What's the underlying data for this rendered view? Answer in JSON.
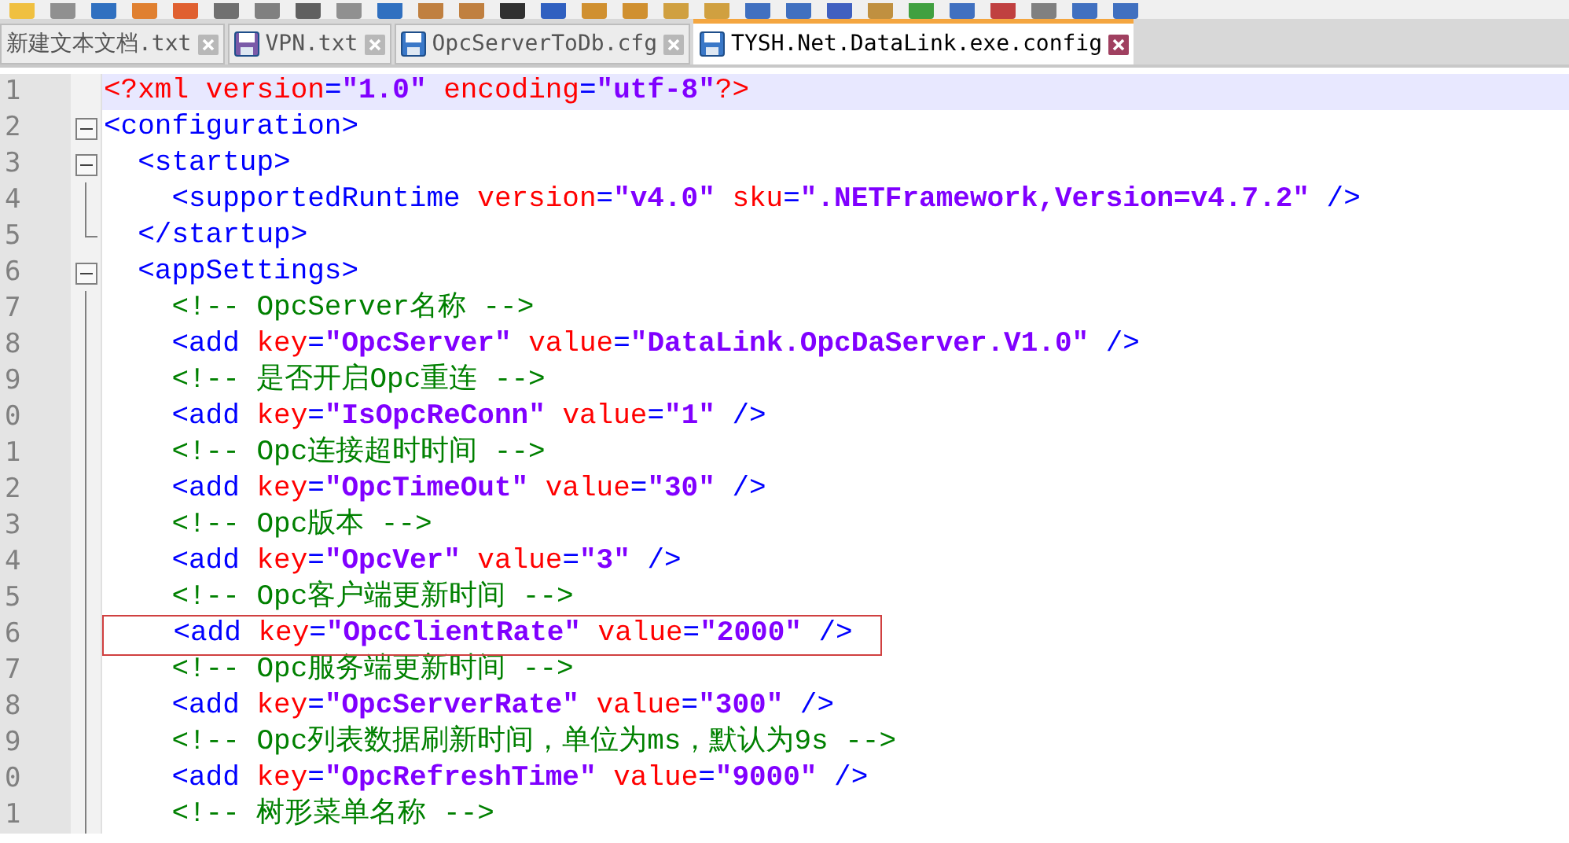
{
  "tabs": [
    {
      "label": "新建文本文档.txt",
      "selected": false,
      "icon": false
    },
    {
      "label": "VPN.txt",
      "selected": false,
      "icon": true,
      "modified": true
    },
    {
      "label": "OpcServerToDb.cfg",
      "selected": false,
      "icon": true,
      "modified": false
    },
    {
      "label": "TYSH.Net.DataLink.exe.config",
      "selected": true,
      "icon": true,
      "modified": false
    }
  ],
  "editor": {
    "lines": [
      {
        "number": "1",
        "kind": "plain",
        "current": true,
        "highlighted": false,
        "tokens": [
          {
            "kind": "pi",
            "text": "<?xml"
          },
          {
            "kind": "pi",
            "text": " version"
          },
          {
            "kind": "tag",
            "text": "="
          },
          {
            "kind": "val",
            "text": "\"1.0\""
          },
          {
            "kind": "pi",
            "text": " encoding"
          },
          {
            "kind": "tag",
            "text": "="
          },
          {
            "kind": "val",
            "text": "\"utf-8\""
          },
          {
            "kind": "pi",
            "text": "?>"
          }
        ]
      },
      {
        "number": "2",
        "kind": "fold-open",
        "current": false,
        "highlighted": false,
        "tokens": [
          {
            "kind": "tag",
            "text": "<configuration>"
          }
        ]
      },
      {
        "number": "3",
        "kind": "fold-open",
        "current": false,
        "highlighted": false,
        "tokens": [
          {
            "kind": "tag",
            "text": "  <startup>"
          }
        ]
      },
      {
        "number": "4",
        "kind": "fold-line",
        "current": false,
        "highlighted": false,
        "tokens": [
          {
            "kind": "tag",
            "text": "    <supportedRuntime"
          },
          {
            "kind": "attr",
            "text": " version"
          },
          {
            "kind": "tag",
            "text": "="
          },
          {
            "kind": "val",
            "text": "\"v4.0\""
          },
          {
            "kind": "attr",
            "text": " sku"
          },
          {
            "kind": "tag",
            "text": "="
          },
          {
            "kind": "val",
            "text": "\".NETFramework,Version=v4.7.2\""
          },
          {
            "kind": "tag",
            "text": " />"
          }
        ]
      },
      {
        "number": "5",
        "kind": "fold-end",
        "current": false,
        "highlighted": false,
        "tokens": [
          {
            "kind": "tag",
            "text": "  </startup>"
          }
        ]
      },
      {
        "number": "6",
        "kind": "fold-open",
        "current": false,
        "highlighted": false,
        "tokens": [
          {
            "kind": "tag",
            "text": "  <appSettings>"
          }
        ]
      },
      {
        "number": "7",
        "kind": "fold-line",
        "current": false,
        "highlighted": false,
        "tokens": [
          {
            "kind": "cmt",
            "text": "    <!-- OpcServer名称 -->"
          }
        ]
      },
      {
        "number": "8",
        "kind": "fold-line",
        "current": false,
        "highlighted": false,
        "tokens": [
          {
            "kind": "tag",
            "text": "    <add"
          },
          {
            "kind": "attr",
            "text": " key"
          },
          {
            "kind": "tag",
            "text": "="
          },
          {
            "kind": "val",
            "text": "\"OpcServer\""
          },
          {
            "kind": "attr",
            "text": " value"
          },
          {
            "kind": "tag",
            "text": "="
          },
          {
            "kind": "val",
            "text": "\"DataLink.OpcDaServer.V1.0\""
          },
          {
            "kind": "tag",
            "text": " />"
          }
        ]
      },
      {
        "number": "9",
        "kind": "fold-line",
        "current": false,
        "highlighted": false,
        "tokens": [
          {
            "kind": "cmt",
            "text": "    <!-- 是否开启Opc重连 -->"
          }
        ]
      },
      {
        "number": "0",
        "kind": "fold-line",
        "current": false,
        "highlighted": false,
        "tokens": [
          {
            "kind": "tag",
            "text": "    <add"
          },
          {
            "kind": "attr",
            "text": " key"
          },
          {
            "kind": "tag",
            "text": "="
          },
          {
            "kind": "val",
            "text": "\"IsOpcReConn\""
          },
          {
            "kind": "attr",
            "text": " value"
          },
          {
            "kind": "tag",
            "text": "="
          },
          {
            "kind": "val",
            "text": "\"1\""
          },
          {
            "kind": "tag",
            "text": " />"
          }
        ]
      },
      {
        "number": "1",
        "kind": "fold-line",
        "current": false,
        "highlighted": false,
        "tokens": [
          {
            "kind": "cmt",
            "text": "    <!-- Opc连接超时时间 -->"
          }
        ]
      },
      {
        "number": "2",
        "kind": "fold-line",
        "current": false,
        "highlighted": false,
        "tokens": [
          {
            "kind": "tag",
            "text": "    <add"
          },
          {
            "kind": "attr",
            "text": " key"
          },
          {
            "kind": "tag",
            "text": "="
          },
          {
            "kind": "val",
            "text": "\"OpcTimeOut\""
          },
          {
            "kind": "attr",
            "text": " value"
          },
          {
            "kind": "tag",
            "text": "="
          },
          {
            "kind": "val",
            "text": "\"30\""
          },
          {
            "kind": "tag",
            "text": " />"
          }
        ]
      },
      {
        "number": "3",
        "kind": "fold-line",
        "current": false,
        "highlighted": false,
        "tokens": [
          {
            "kind": "cmt",
            "text": "    <!-- Opc版本 -->"
          }
        ]
      },
      {
        "number": "4",
        "kind": "fold-line",
        "current": false,
        "highlighted": false,
        "tokens": [
          {
            "kind": "tag",
            "text": "    <add"
          },
          {
            "kind": "attr",
            "text": " key"
          },
          {
            "kind": "tag",
            "text": "="
          },
          {
            "kind": "val",
            "text": "\"OpcVer\""
          },
          {
            "kind": "attr",
            "text": " value"
          },
          {
            "kind": "tag",
            "text": "="
          },
          {
            "kind": "val",
            "text": "\"3\""
          },
          {
            "kind": "tag",
            "text": " />"
          }
        ]
      },
      {
        "number": "5",
        "kind": "fold-line",
        "current": false,
        "highlighted": false,
        "tokens": [
          {
            "kind": "cmt",
            "text": "    <!-- Opc客户端更新时间 -->"
          }
        ]
      },
      {
        "number": "6",
        "kind": "fold-line",
        "current": false,
        "highlighted": true,
        "tokens": [
          {
            "kind": "tag",
            "text": "    <add"
          },
          {
            "kind": "attr",
            "text": " key"
          },
          {
            "kind": "tag",
            "text": "="
          },
          {
            "kind": "val",
            "text": "\"OpcClientRate\""
          },
          {
            "kind": "attr",
            "text": " value"
          },
          {
            "kind": "tag",
            "text": "="
          },
          {
            "kind": "val",
            "text": "\"2000\""
          },
          {
            "kind": "tag",
            "text": " />"
          }
        ]
      },
      {
        "number": "7",
        "kind": "fold-line",
        "current": false,
        "highlighted": false,
        "tokens": [
          {
            "kind": "cmt",
            "text": "    <!-- Opc服务端更新时间 -->"
          }
        ]
      },
      {
        "number": "8",
        "kind": "fold-line",
        "current": false,
        "highlighted": false,
        "tokens": [
          {
            "kind": "tag",
            "text": "    <add"
          },
          {
            "kind": "attr",
            "text": " key"
          },
          {
            "kind": "tag",
            "text": "="
          },
          {
            "kind": "val",
            "text": "\"OpcServerRate\""
          },
          {
            "kind": "attr",
            "text": " value"
          },
          {
            "kind": "tag",
            "text": "="
          },
          {
            "kind": "val",
            "text": "\"300\""
          },
          {
            "kind": "tag",
            "text": " />"
          }
        ]
      },
      {
        "number": "9",
        "kind": "fold-line",
        "current": false,
        "highlighted": false,
        "tokens": [
          {
            "kind": "cmt",
            "text": "    <!-- Opc列表数据刷新时间，单位为ms，默认为9s -->"
          }
        ]
      },
      {
        "number": "0",
        "kind": "fold-line",
        "current": false,
        "highlighted": false,
        "tokens": [
          {
            "kind": "tag",
            "text": "    <add"
          },
          {
            "kind": "attr",
            "text": " key"
          },
          {
            "kind": "tag",
            "text": "="
          },
          {
            "kind": "val",
            "text": "\"OpcRefreshTime\""
          },
          {
            "kind": "attr",
            "text": " value"
          },
          {
            "kind": "tag",
            "text": "="
          },
          {
            "kind": "val",
            "text": "\"9000\""
          },
          {
            "kind": "tag",
            "text": " />"
          }
        ]
      },
      {
        "number": "1",
        "kind": "fold-line",
        "current": false,
        "highlighted": false,
        "tokens": [
          {
            "kind": "cmt",
            "text": "    <!-- 树形菜单名称 -->"
          }
        ]
      }
    ]
  }
}
